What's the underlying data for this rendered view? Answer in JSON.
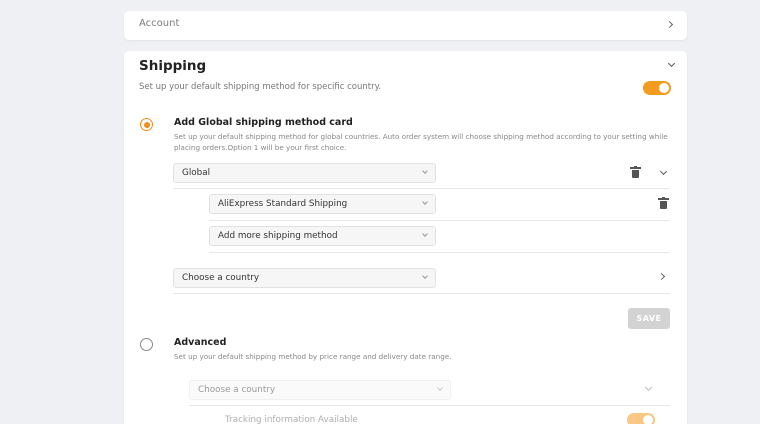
{
  "account": {
    "label": "Account"
  },
  "shipping": {
    "title": "Shipping",
    "subtitle": "Set up your default shipping method for specific country.",
    "enabled": true,
    "global_option": {
      "title": "Add Global shipping method card",
      "description": "Set up your default shipping method for global countries. Auto order system will choose shipping method according to your setting while placing orders.Option 1 will be your first choice.",
      "selected": true,
      "region_select": "Global",
      "method_select": "AliExpress Standard Shipping",
      "more_select": "Add more shipping method",
      "country_select": "Choose a country"
    },
    "save_label": "SAVE",
    "advanced_option": {
      "title": "Advanced",
      "description": "Set up your default shipping method by price range and delivery date range.",
      "selected": false,
      "country_select": "Choose a country",
      "tracking_label": "Tracking information Available",
      "tracking_enabled": true
    }
  },
  "colors": {
    "accent": "#f39c1f",
    "radio": "#f08c1a",
    "page_bg": "#eef0f3"
  },
  "icons": [
    "chevron-right-icon",
    "chevron-down-icon",
    "trash-icon",
    "dropdown-arrow-icon"
  ]
}
